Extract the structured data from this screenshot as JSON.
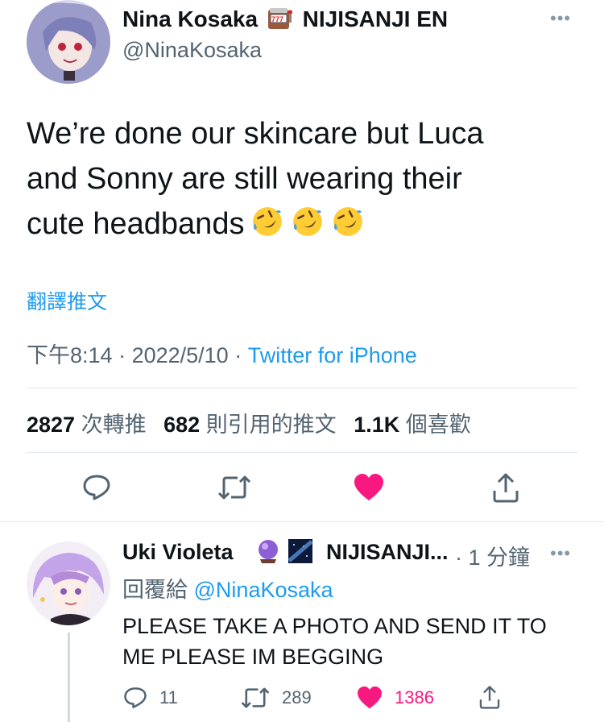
{
  "tweet": {
    "author_name": "Nina Kosaka",
    "author_org": "NIJISANJI EN",
    "handle": "@NinaKosaka",
    "badge_icon": "slot-machine-icon",
    "text_line1": "We’re done our skincare but Luca",
    "text_line2": "and Sonny are still wearing their",
    "text_line3": "cute headbands",
    "emoji_icon": "rolling-on-floor-laughing-icon",
    "translate_label": "翻譯推文",
    "time": "下午8:14",
    "separator": " · ",
    "date": "2022/5/10",
    "source": "Twitter for iPhone"
  },
  "stats": {
    "retweets_count": "2827",
    "retweets_label": "次轉推",
    "quotes_count": "682",
    "quotes_label": "則引用的推文",
    "likes_count": "1.1K",
    "likes_label": "個喜歡"
  },
  "actions": [
    "reply-icon",
    "retweet-icon",
    "heart-filled-icon",
    "share-icon"
  ],
  "reply": {
    "author_name": "Uki Violeta",
    "author_org": "NIJISANJI...",
    "time": "· 1 分鐘",
    "replying_label": "回覆給 ",
    "replying_to": "@NinaKosaka",
    "text_line1": "PLEASE TAKE A PHOTO AND SEND IT TO",
    "text_line2": "ME PLEASE IM BEGGING",
    "reply_count": "11",
    "retweet_count": "289",
    "like_count": "1386",
    "badge_icons": [
      "crystal-ball-icon",
      "milky-way-icon"
    ]
  },
  "colors": {
    "accent": "#1d9bf0",
    "like": "#f91880",
    "muted": "#536471",
    "text": "#0f1419"
  }
}
